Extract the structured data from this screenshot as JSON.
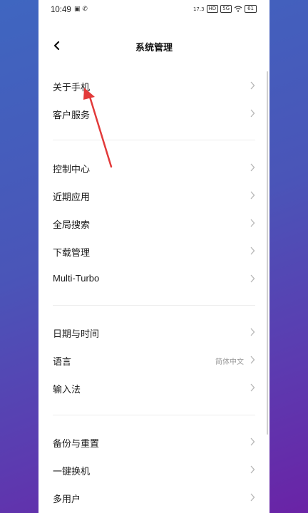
{
  "status_bar": {
    "time": "10:49",
    "left_icons": [
      "image-icon",
      "phone-icon"
    ],
    "right_icons": [
      "hd-icon",
      "5g-icon",
      "wifi-icon"
    ],
    "speed": "17.3",
    "battery": "61"
  },
  "header": {
    "title": "系统管理"
  },
  "groups": [
    {
      "items": [
        {
          "label": "关于手机",
          "value": ""
        },
        {
          "label": "客户服务",
          "value": ""
        }
      ]
    },
    {
      "items": [
        {
          "label": "控制中心",
          "value": ""
        },
        {
          "label": "近期应用",
          "value": ""
        },
        {
          "label": "全局搜索",
          "value": ""
        },
        {
          "label": "下载管理",
          "value": ""
        },
        {
          "label": "Multi-Turbo",
          "value": ""
        }
      ]
    },
    {
      "items": [
        {
          "label": "日期与时间",
          "value": ""
        },
        {
          "label": "语言",
          "value": "简体中文"
        },
        {
          "label": "输入法",
          "value": ""
        }
      ]
    },
    {
      "items": [
        {
          "label": "备份与重置",
          "value": ""
        },
        {
          "label": "一键换机",
          "value": ""
        },
        {
          "label": "多用户",
          "value": ""
        }
      ]
    }
  ],
  "annotation": {
    "color": "#e23a3a",
    "icon": "red-arrow-icon"
  }
}
